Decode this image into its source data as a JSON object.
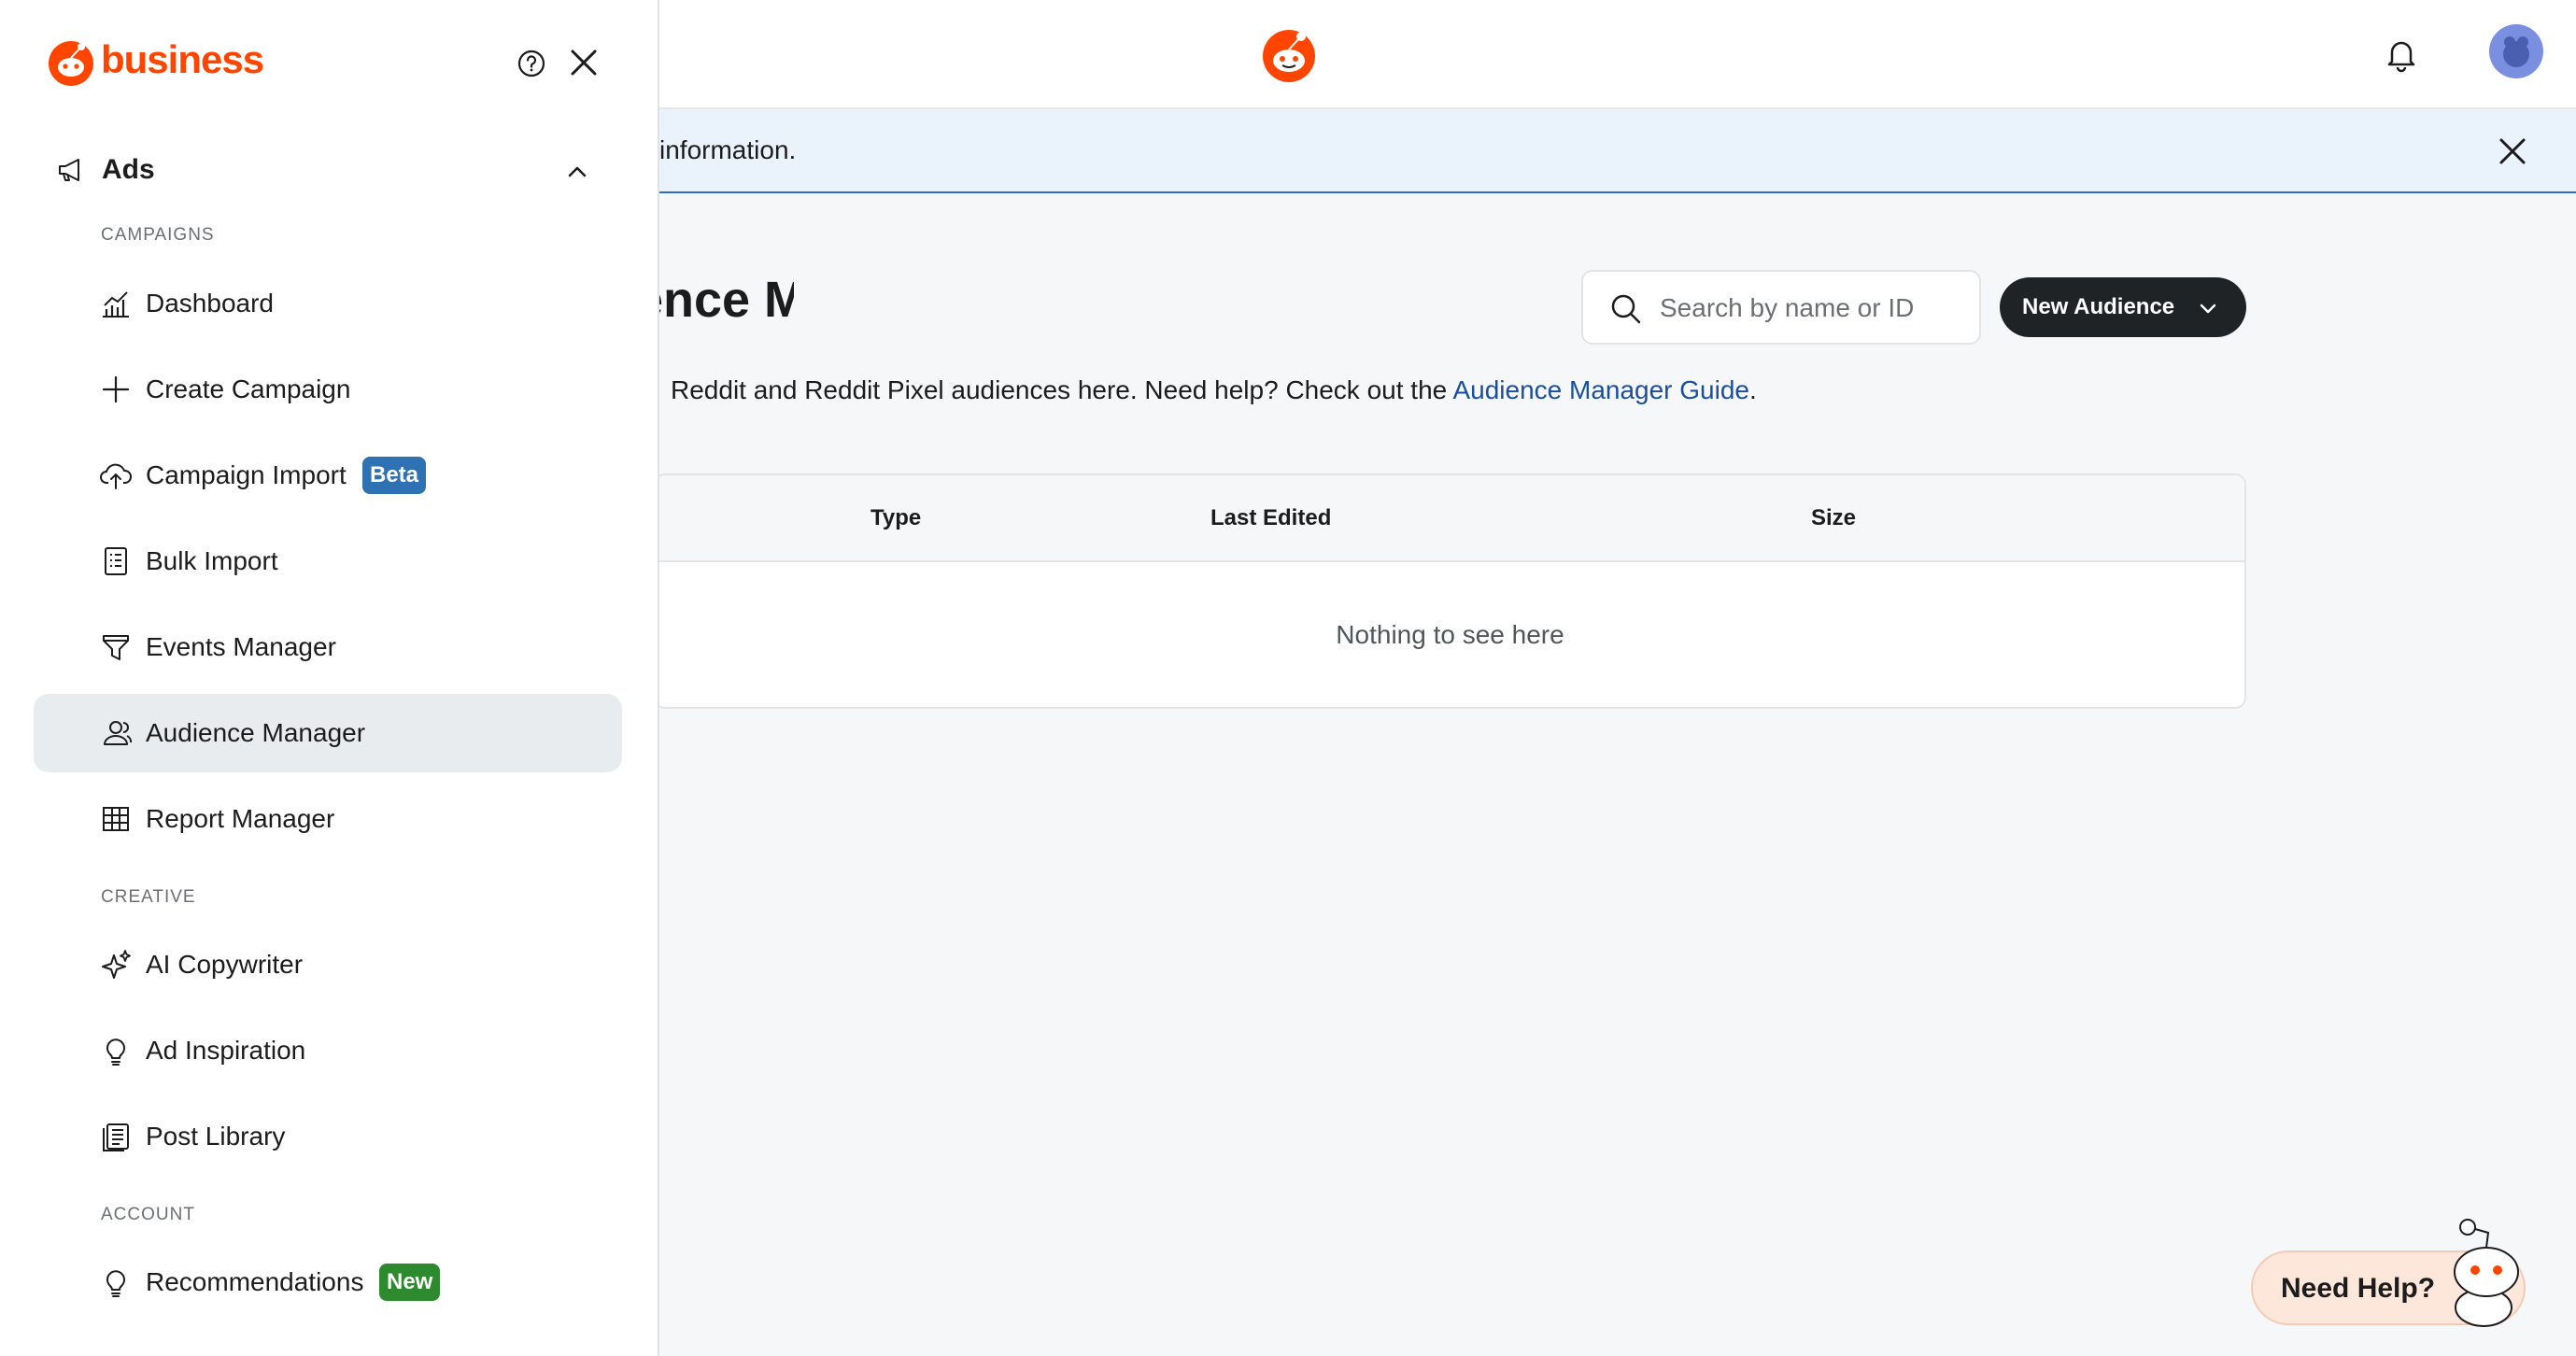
{
  "header": {
    "logo_icon": "reddit-snoo-icon",
    "notifications_icon": "bell-icon",
    "avatar_icon": "user-avatar-icon"
  },
  "banner": {
    "text": "information.",
    "close_icon": "close-icon"
  },
  "main": {
    "title": "Audience Manager",
    "search_placeholder": "Search by name or ID",
    "new_audience_label": "New Audience",
    "description_prefix": "Reddit and Reddit Pixel audiences here. Need help? Check out the ",
    "description_link": "Audience Manager Guide",
    "description_suffix": ".",
    "table": {
      "columns": [
        "Type",
        "Last Edited",
        "Size"
      ],
      "empty_text": "Nothing to see here"
    },
    "need_help_label": "Need Help?"
  },
  "drawer": {
    "brand": "business",
    "help_icon": "question-circle-icon",
    "close_icon": "close-icon",
    "ads_label": "Ads",
    "sections": {
      "campaigns": "CAMPAIGNS",
      "creative": "CREATIVE",
      "account": "ACCOUNT"
    },
    "items": [
      {
        "label": "Dashboard",
        "icon": "chart-icon"
      },
      {
        "label": "Create Campaign",
        "icon": "plus-icon"
      },
      {
        "label": "Campaign Import",
        "icon": "upload-icon",
        "badge": "Beta"
      },
      {
        "label": "Bulk Import",
        "icon": "document-list-icon"
      },
      {
        "label": "Events Manager",
        "icon": "funnel-icon"
      },
      {
        "label": "Audience Manager",
        "icon": "users-icon",
        "active": true
      },
      {
        "label": "Report Manager",
        "icon": "table-icon"
      },
      {
        "label": "AI Copywriter",
        "icon": "sparkle-icon"
      },
      {
        "label": "Ad Inspiration",
        "icon": "lightbulb-icon"
      },
      {
        "label": "Post Library",
        "icon": "library-icon"
      },
      {
        "label": "Recommendations",
        "icon": "lightbulb-icon",
        "badge": "New"
      }
    ]
  },
  "colors": {
    "brand": "#ff4500",
    "primary_button": "#1f2326",
    "link": "#1a4fa0",
    "beta_badge": "#2f72b4",
    "new_badge": "#2e8a2e"
  }
}
